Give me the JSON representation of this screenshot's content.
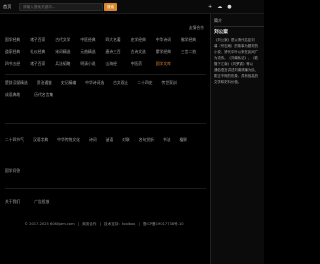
{
  "topbar": {
    "home": "首页",
    "search_placeholder": "请输入搜索关键词...",
    "search_button": "搜索",
    "icons": [
      "plus-icon",
      "chat-icon",
      "user-icon"
    ],
    "icon_glyphs": {
      "plus": "+",
      "chat": "☁",
      "user": "●"
    }
  },
  "friend_link_label": "友情合作",
  "rows": [
    [
      "国学经典",
      "诸子百家",
      "古代文学",
      "中医经典",
      "四大名著",
      "史学经典",
      "中华诗词",
      "佛学经典"
    ],
    [
      "道家经典",
      "礼仪经典",
      "宋词精选",
      "元曲精选",
      "唐诗三百",
      "古诗文选",
      "蒙学经典",
      "三言二拍"
    ],
    [
      "四书五经",
      "诸子百家",
      "兵法韬略",
      "明清小说",
      "山海经",
      "中医药",
      "国学文库"
    ]
  ],
  "row_highlight": "国学文库",
  "row4": [
    "楚辞汉赋精选",
    "资治通鉴",
    "史记精编",
    "中华诗词选",
    "古文观止",
    "二十四史",
    "传世家训"
  ],
  "row5": [
    "成语典故",
    "历代名言集"
  ],
  "row6": [
    "二十四节气",
    "汉语字典",
    "中华传统文化",
    "诗词",
    "谜语",
    "对联",
    "名句赏析",
    "书法",
    "楹联"
  ],
  "row7": [
    "国学问答"
  ],
  "row8": [
    "关于我们",
    "广告投放"
  ],
  "footer": {
    "copyright": "© 2017-2025 6080jam.com",
    "sep1": "|",
    "business": "商务合作",
    "sep2": "|",
    "support": "技术支持：toolbox",
    "sep3": "|",
    "icp": "鲁ICP备19017738号-10"
  },
  "sidepanel": {
    "title": "简介",
    "name": "刘公案",
    "lines": [
      "《刘公案》是以清代名臣刘",
      "墉（号石庵）的故事为题材的",
      "小说，清代中叶以来在民间广",
      "为流传。《刘墉私访》、《乾",
      "隆下江南》《刘罗锅》等以",
      "通俗语言讲述刘墉清廉为民、",
      "刚正不阿的形象，具有极高的",
      "文学和史料价值。"
    ]
  }
}
